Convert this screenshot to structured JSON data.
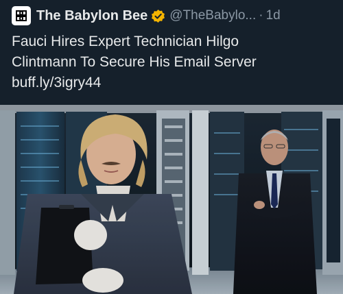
{
  "tweet": {
    "author": {
      "display_name": "The Babylon Bee",
      "handle": "@TheBabylo...",
      "verified_badge_color": "#f4b400"
    },
    "separator": "·",
    "timestamp": "1d",
    "text_lines": [
      "Fauci Hires Expert Technician Hilgo",
      "Clintmann To Secure His Email Server",
      "buff.ly/3igry44"
    ]
  },
  "colors": {
    "background": "#15202b",
    "text_primary": "#e7e9ea",
    "text_secondary": "#8b98a5",
    "verified_gold": "#f4b400"
  },
  "icons": {
    "avatar": "babylon-bee-logo-icon",
    "verified": "verified-badge-icon"
  }
}
